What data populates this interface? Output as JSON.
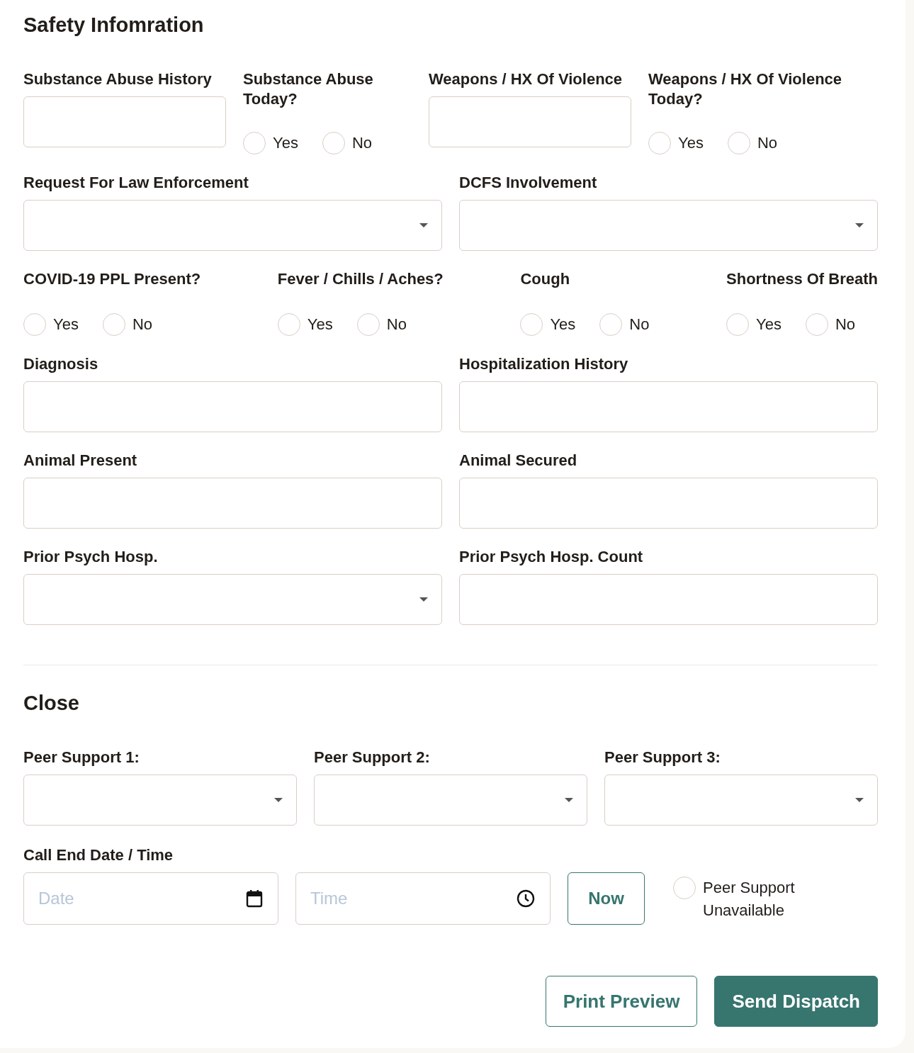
{
  "sections": [
    {
      "title": "Safety Infomration",
      "rows": [
        {
          "kind": "quad",
          "fields": [
            {
              "kind": "text",
              "label": "Substance Abuse History"
            },
            {
              "kind": "radio",
              "label": "Substance Abuse Today?",
              "options": [
                {
                  "label": "Yes",
                  "selected": false
                },
                {
                  "label": "No",
                  "selected": false
                }
              ]
            },
            {
              "kind": "text",
              "label": "Weapons / HX Of Violence"
            },
            {
              "kind": "radio",
              "label": "Weapons / HX Of Violence Today?",
              "options": [
                {
                  "label": "Yes",
                  "selected": false
                },
                {
                  "label": "No",
                  "selected": false
                }
              ]
            }
          ]
        },
        {
          "kind": "pair",
          "fields": [
            {
              "kind": "select",
              "label": "Request For Law Enforcement"
            },
            {
              "kind": "select",
              "label": "DCFS Involvement"
            }
          ]
        },
        {
          "kind": "spread",
          "fields": [
            {
              "kind": "radio",
              "label": "COVID-19 PPL Present?",
              "options": [
                {
                  "label": "Yes",
                  "selected": false
                },
                {
                  "label": "No",
                  "selected": false
                }
              ]
            },
            {
              "kind": "radio",
              "label": "Fever / Chills / Aches?",
              "options": [
                {
                  "label": "Yes",
                  "selected": false
                },
                {
                  "label": "No",
                  "selected": false
                }
              ]
            },
            {
              "kind": "radio",
              "label": "Cough",
              "options": [
                {
                  "label": "Yes",
                  "selected": false
                },
                {
                  "label": "No",
                  "selected": false
                }
              ]
            },
            {
              "kind": "radio",
              "label": "Shortness Of Breath",
              "options": [
                {
                  "label": "Yes",
                  "selected": false
                },
                {
                  "label": "No",
                  "selected": false
                }
              ]
            }
          ]
        },
        {
          "kind": "pair",
          "fields": [
            {
              "kind": "text",
              "label": "Diagnosis"
            },
            {
              "kind": "text",
              "label": "Hospitalization History"
            }
          ]
        },
        {
          "kind": "pair",
          "fields": [
            {
              "kind": "text",
              "label": "Animal Present"
            },
            {
              "kind": "text",
              "label": "Animal Secured"
            }
          ]
        },
        {
          "kind": "pair",
          "fields": [
            {
              "kind": "select",
              "label": "Prior Psych Hosp."
            },
            {
              "kind": "text",
              "label": "Prior Psych Hosp. Count"
            }
          ]
        }
      ]
    },
    {
      "title": "Close",
      "rows": [
        {
          "kind": "triple",
          "fields": [
            {
              "kind": "select",
              "label": "Peer Support 1:"
            },
            {
              "kind": "select",
              "label": "Peer Support 2:"
            },
            {
              "kind": "select",
              "label": "Peer Support 3:"
            }
          ]
        }
      ]
    }
  ],
  "call_end": {
    "label": "Call End Date / Time",
    "date": {
      "placeholder": "Date"
    },
    "time": {
      "placeholder": "Time"
    },
    "now_button": "Now",
    "unavailable": {
      "label": "Peer Support Unavailable",
      "checked": false
    }
  },
  "actions": [
    {
      "label": "Print Preview",
      "kind": "outline"
    },
    {
      "label": "Send Dispatch",
      "kind": "primary"
    }
  ]
}
